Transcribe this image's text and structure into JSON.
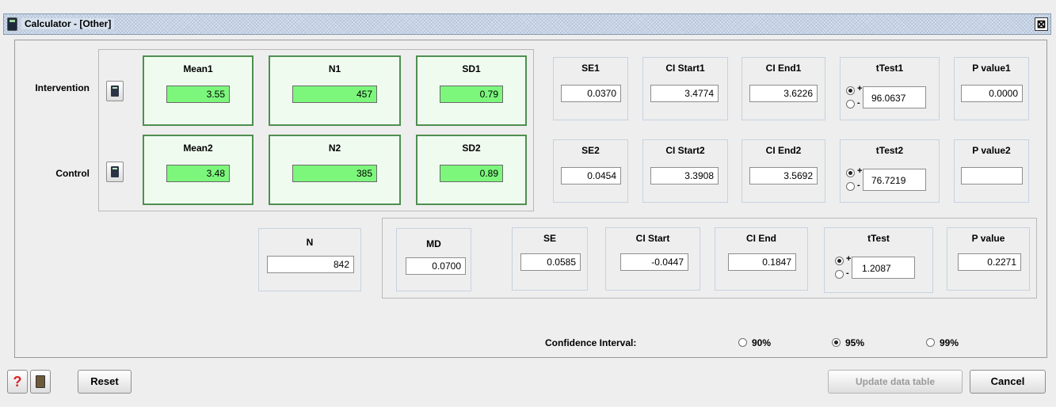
{
  "window": {
    "title": "Calculator - [Other]",
    "close_glyph": "⊠"
  },
  "rows": {
    "intervention": {
      "label": "Intervention",
      "mean": {
        "label": "Mean1",
        "value": "3.55"
      },
      "n": {
        "label": "N1",
        "value": "457"
      },
      "sd": {
        "label": "SD1",
        "value": "0.79"
      },
      "se": {
        "label": "SE1",
        "value": "0.0370"
      },
      "ci_start": {
        "label": "CI Start1",
        "value": "3.4774"
      },
      "ci_end": {
        "label": "CI End1",
        "value": "3.6226"
      },
      "ttest": {
        "label": "tTest1",
        "value": "96.0637",
        "plus": "+",
        "minus": "-"
      },
      "pvalue": {
        "label": "P value1",
        "value": "0.0000"
      }
    },
    "control": {
      "label": "Control",
      "mean": {
        "label": "Mean2",
        "value": "3.48"
      },
      "n": {
        "label": "N2",
        "value": "385"
      },
      "sd": {
        "label": "SD2",
        "value": "0.89"
      },
      "se": {
        "label": "SE2",
        "value": "0.0454"
      },
      "ci_start": {
        "label": "CI Start2",
        "value": "3.3908"
      },
      "ci_end": {
        "label": "CI End2",
        "value": "3.5692"
      },
      "ttest": {
        "label": "tTest2",
        "value": "76.7219",
        "plus": "+",
        "minus": "-"
      },
      "pvalue": {
        "label": "P value2",
        "value": ""
      }
    }
  },
  "totals": {
    "n": {
      "label": "N",
      "value": "842"
    },
    "md": {
      "label": "MD",
      "value": "0.0700"
    },
    "se": {
      "label": "SE",
      "value": "0.0585"
    },
    "ci_start": {
      "label": "CI Start",
      "value": "-0.0447"
    },
    "ci_end": {
      "label": "CI End",
      "value": "0.1847"
    },
    "ttest": {
      "label": "tTest",
      "value": "1.2087",
      "plus": "+",
      "minus": "-"
    },
    "pvalue": {
      "label": "P value",
      "value": "0.2271"
    }
  },
  "confidence": {
    "label": "Confidence Interval:",
    "options": [
      "90%",
      "95%",
      "99%"
    ],
    "selected": "95%"
  },
  "footer": {
    "help_glyph": "?",
    "reset": "Reset",
    "update": "Update data table",
    "cancel": "Cancel"
  },
  "colors": {
    "input_green": "#7cf77c",
    "box_green_border": "#4f8f50",
    "title_bar": "#d7e1ee"
  }
}
